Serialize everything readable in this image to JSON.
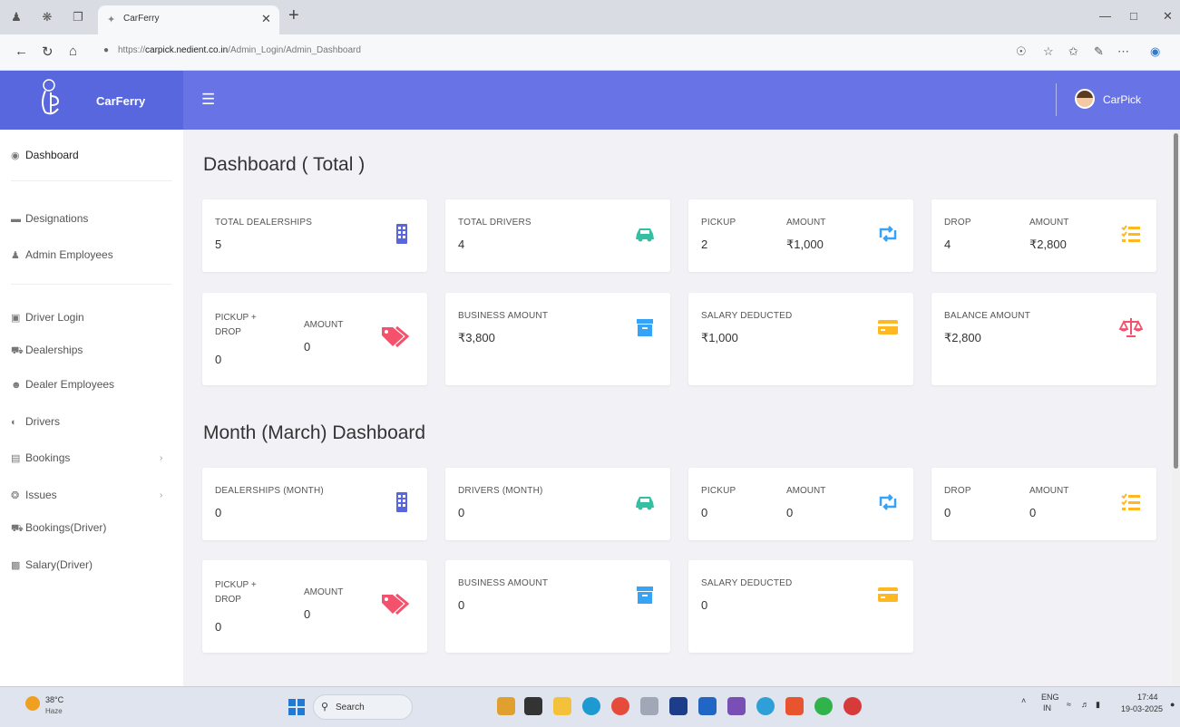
{
  "browser": {
    "tab_title": "CarFerry",
    "url_prefix": "https://",
    "url_host": "carpick.nedient.co.in",
    "url_path": "/Admin_Login/Admin_Dashboard"
  },
  "app": {
    "brand": "CarFerry",
    "user": "CarPick"
  },
  "sidebar": {
    "items": [
      {
        "label": "Dashboard",
        "icon": "tachometer-icon"
      },
      {
        "label": "Designations",
        "icon": "graduation-cap-icon"
      },
      {
        "label": "Admin Employees",
        "icon": "user-plus-icon"
      },
      {
        "label": "Driver Login",
        "icon": "id-card-icon"
      },
      {
        "label": "Dealerships",
        "icon": "car-icon"
      },
      {
        "label": "Dealer Employees",
        "icon": "users-icon"
      },
      {
        "label": "Drivers",
        "icon": "user-circle-icon"
      },
      {
        "label": "Bookings",
        "icon": "list-icon"
      },
      {
        "label": "Issues",
        "icon": "support-icon"
      },
      {
        "label": "Bookings(Driver)",
        "icon": "car-icon"
      },
      {
        "label": "Salary(Driver)",
        "icon": "money-icon"
      }
    ]
  },
  "total": {
    "heading": "Dashboard ( Total )",
    "dealerships": {
      "label": "TOTAL DEALERSHIPS",
      "value": "5"
    },
    "drivers": {
      "label": "TOTAL DRIVERS",
      "value": "4"
    },
    "pickup": {
      "label": "PICKUP",
      "value": "2",
      "amount_label": "AMOUNT",
      "amount": "₹1,000"
    },
    "drop": {
      "label": "DROP",
      "value": "4",
      "amount_label": "AMOUNT",
      "amount": "₹2,800"
    },
    "pickup_drop": {
      "label": "PICKUP + DROP",
      "value": "0",
      "amount_label": "AMOUNT",
      "amount": "0"
    },
    "business": {
      "label": "BUSINESS AMOUNT",
      "value": "₹3,800"
    },
    "salary": {
      "label": "SALARY DEDUCTED",
      "value": "₹1,000"
    },
    "balance": {
      "label": "BALANCE AMOUNT",
      "value": "₹2,800"
    }
  },
  "month": {
    "heading": "Month (March) Dashboard",
    "dealerships": {
      "label": "DEALERSHIPS (MONTH)",
      "value": "0"
    },
    "drivers": {
      "label": "DRIVERS (MONTH)",
      "value": "0"
    },
    "pickup": {
      "label": "PICKUP",
      "value": "0",
      "amount_label": "AMOUNT",
      "amount": "0"
    },
    "drop": {
      "label": "DROP",
      "value": "0",
      "amount_label": "AMOUNT",
      "amount": "0"
    },
    "pickup_drop": {
      "label": "PICKUP + DROP",
      "value": "0",
      "amount_label": "AMOUNT",
      "amount": "0"
    },
    "business": {
      "label": "BUSINESS AMOUNT",
      "value": "0"
    },
    "salary": {
      "label": "SALARY DEDUCTED",
      "value": "0"
    }
  },
  "colors": {
    "header": "#6873e6",
    "brand": "#5867dd",
    "building": "#5867dd",
    "car": "#34bfa3",
    "retweet": "#36a3f7",
    "tasks": "#ffb822",
    "tag": "#f4516c",
    "archive": "#36a3f7",
    "card": "#ffb822",
    "balance": "#f4516c"
  },
  "taskbar": {
    "temp": "38°C",
    "weather": "Haze",
    "search": "Search",
    "lang": "ENG",
    "region": "IN",
    "time": "17:44",
    "date": "19-03-2025"
  }
}
